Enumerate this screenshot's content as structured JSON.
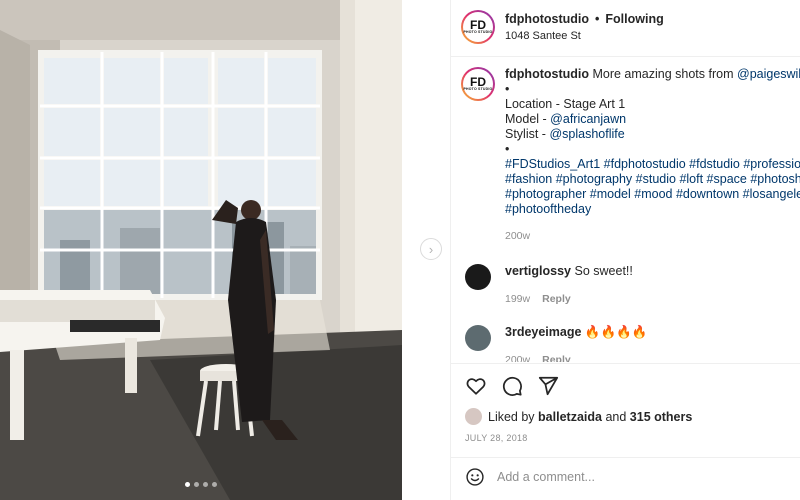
{
  "post": {
    "account": "fdphotostudio",
    "avatar": {
      "letters": "FD",
      "sub": "PHOTO STUDIO"
    },
    "follow_separator": "•",
    "follow_status": "Following",
    "location": "1048 Santee St"
  },
  "caption": {
    "username": "fdphotostudio",
    "intro": "More amazing shots from",
    "intro_mention": "@paigeswilso",
    "bullet1": "•",
    "location_line": "Location - Stage Art 1",
    "model_label": "Model -",
    "model_mention": "@africanjawn",
    "stylist_label": "Stylist -",
    "stylist_mention": "@splashoflife",
    "bullet2": "•",
    "hashtag_line1": "#FDStudios_Art1 #fdphotostudio #fdstudio #professio",
    "hashtag_line2": "#fashion #photography #studio #loft #space #photosh",
    "hashtag_line3": "#photographer #model #mood #downtown #losangele",
    "hashtag_line4": "#photooftheday",
    "time": "200w"
  },
  "comments": [
    {
      "username": "vertiglossy",
      "text": "So sweet!!",
      "time": "199w",
      "reply": "Reply",
      "avatar_color": "#1a1a1a"
    },
    {
      "username": "3rdeyeimage",
      "text": "🔥🔥🔥🔥",
      "time": "200w",
      "reply": "Reply",
      "avatar_color": "#5d6b70"
    }
  ],
  "actions": {
    "like_icon": "heart-icon",
    "comment_icon": "comment-icon",
    "share_icon": "share-icon"
  },
  "likes": {
    "prefix": "Liked by",
    "user": "balletzaida",
    "connector": "and",
    "others": "315 others"
  },
  "date": "JULY 28, 2018",
  "add_comment": {
    "placeholder": "Add a comment..."
  },
  "nav": {
    "next_icon": "›"
  },
  "photo": {
    "slides": 4,
    "active_slide": 1
  }
}
